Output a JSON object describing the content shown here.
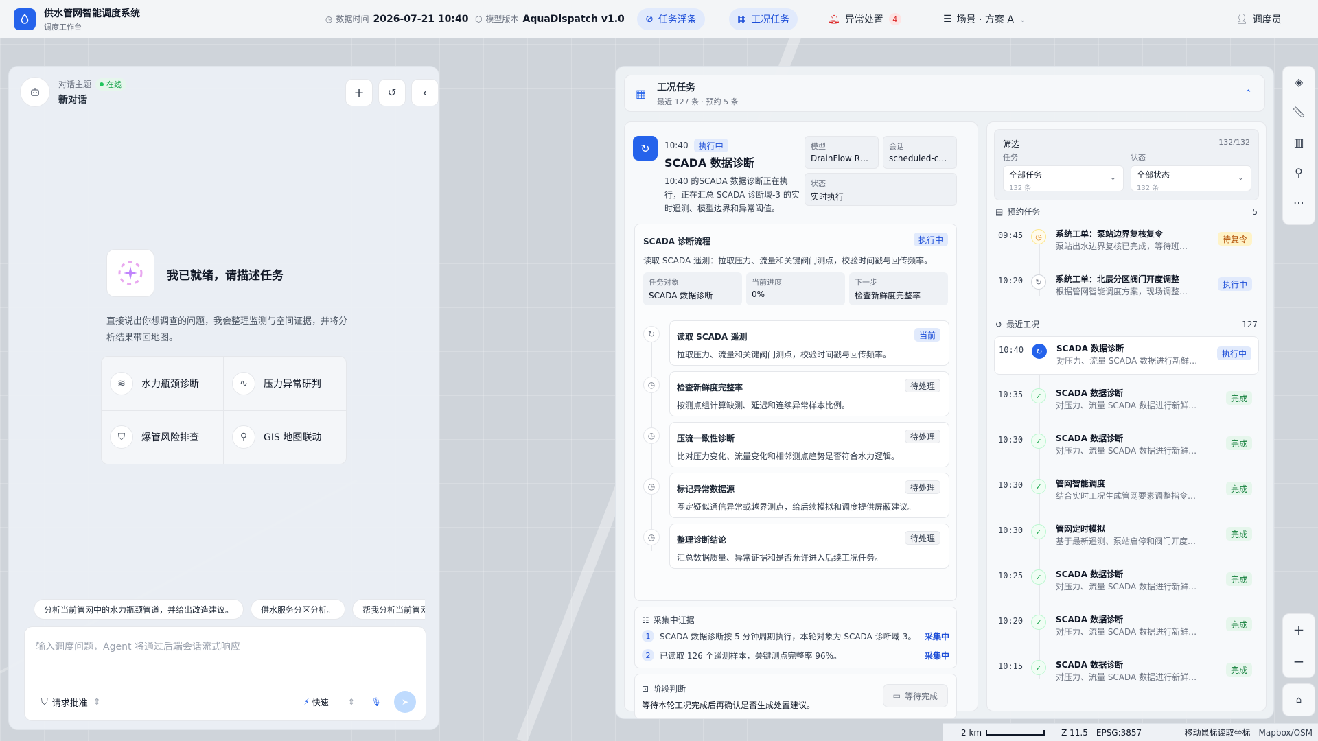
{
  "header": {
    "app_title": "供水管网智能调度系统",
    "app_subtitle": "调度工作台",
    "data_time_label": "数据时间",
    "data_time": "2026-07-21 10:40",
    "model_label": "模型版本",
    "model": "AquaDispatch v1.0",
    "nav": {
      "float_tasks": "任务浮条",
      "work_tasks": "工况任务",
      "anomaly": "异常处置",
      "anomaly_count": "4",
      "scenario": "场景 · 方案 A",
      "user": "调度员"
    }
  },
  "chat": {
    "topic_label": "对话主题",
    "status": "在线",
    "title": "新对话",
    "hero_title": "我已就绪，请描述任务",
    "hero_desc": "直接说出你想调查的问题，我会整理监测与空间证据，并将分析结果带回地图。",
    "quick": [
      "水力瓶颈诊断",
      "压力异常研判",
      "爆管风险排查",
      "GIS 地图联动"
    ],
    "suggestions": [
      "分析当前管网中的水力瓶颈管道，并给出改造建议。",
      "供水服务分区分析。",
      "帮我分析当前管网"
    ],
    "input_placeholder": "输入调度问题，Agent 将通过后端会话流式响应",
    "approval": "请求批准",
    "mode": "快速"
  },
  "tasks": {
    "title": "工况任务",
    "subtitle": "最近 127 条 · 预约 5 条",
    "detail": {
      "time": "10:40",
      "status": "执行中",
      "title": "SCADA 数据诊断",
      "desc": "10:40 的SCADA 数据诊断正在执行，正在汇总 SCADA 诊断域-3 的实时遥测、模型边界和异常阈值。",
      "model_label": "模型",
      "model": "DrainFlow R…",
      "session_label": "会话",
      "session": "scheduled-c…",
      "state_label": "状态",
      "state": "实时执行",
      "flow_title": "SCADA 诊断流程",
      "flow_status": "执行中",
      "flow_desc": "读取 SCADA 遥测：拉取压力、流量和关键阀门测点，校验时间戳与回传频率。",
      "target_label": "任务对象",
      "target": "SCADA 数据诊断",
      "progress_label": "当前进度",
      "progress": "0%",
      "next_label": "下一步",
      "next": "检查新鲜度完整率",
      "steps": [
        {
          "title": "读取 SCADA 遥测",
          "desc": "拉取压力、流量和关键阀门测点，校验时间戳与回传频率。",
          "status": "当前"
        },
        {
          "title": "检查新鲜度完整率",
          "desc": "按测点组计算缺测、延迟和连续异常样本比例。",
          "status": "待处理"
        },
        {
          "title": "压流一致性诊断",
          "desc": "比对压力变化、流量变化和相邻测点趋势是否符合水力逻辑。",
          "status": "待处理"
        },
        {
          "title": "标记异常数据源",
          "desc": "圈定疑似通信异常或越界测点，给后续模拟和调度提供屏蔽建议。",
          "status": "待处理"
        },
        {
          "title": "整理诊断结论",
          "desc": "汇总数据质量、异常证据和是否允许进入后续工况任务。",
          "status": "待处理"
        }
      ],
      "evidence_title": "采集中证据",
      "evidence": [
        {
          "n": "1",
          "text": "SCADA 数据诊断按 5 分钟周期执行，本轮对象为 SCADA 诊断域-3。",
          "status": "采集中"
        },
        {
          "n": "2",
          "text": "已读取 126 个遥测样本，关键测点完整率 96%。",
          "status": "采集中"
        }
      ],
      "judge_title": "阶段判断",
      "judge_desc": "等待本轮工况完成后再确认是否生成处置建议。",
      "judge_btn": "等待完成"
    },
    "filter": {
      "label": "筛选",
      "count": "132/132",
      "task_label": "任务",
      "task_value": "全部任务",
      "task_count": "132 条",
      "state_label": "状态",
      "state_value": "全部状态",
      "state_count": "132 条"
    },
    "scheduled_label": "预约任务",
    "scheduled_count": "5",
    "scheduled": [
      {
        "time": "09:45",
        "title": "系统工单：泵站边界复核复令",
        "desc": "泵站出水边界复核已完成，等待班…",
        "status": "待复令"
      },
      {
        "time": "10:20",
        "title": "系统工单：北辰分区阀门开度调整",
        "desc": "根据管网智能调度方案，现场调整…",
        "status": "执行中"
      }
    ],
    "recent_label": "最近工况",
    "recent_count": "127",
    "recent": [
      {
        "time": "10:40",
        "title": "SCADA 数据诊断",
        "desc": "对压力、流量 SCADA 数据进行新鲜…",
        "status": "执行中"
      },
      {
        "time": "10:35",
        "title": "SCADA 数据诊断",
        "desc": "对压力、流量 SCADA 数据进行新鲜度…",
        "status": "完成"
      },
      {
        "time": "10:30",
        "title": "SCADA 数据诊断",
        "desc": "对压力、流量 SCADA 数据进行新鲜…",
        "status": "完成"
      },
      {
        "time": "10:30",
        "title": "管网智能调度",
        "desc": "结合实时工况生成管网要素调整指令…",
        "status": "完成"
      },
      {
        "time": "10:30",
        "title": "管网定时模拟",
        "desc": "基于最新遥测、泵站启停和阀门开度…",
        "status": "完成"
      },
      {
        "time": "10:25",
        "title": "SCADA 数据诊断",
        "desc": "对压力、流量 SCADA 数据进行新鲜度…",
        "status": "完成"
      },
      {
        "time": "10:20",
        "title": "SCADA 数据诊断",
        "desc": "对压力、流量 SCADA 数据进行新鲜度…",
        "status": "完成"
      },
      {
        "time": "10:15",
        "title": "SCADA 数据诊断",
        "desc": "对压力、流量 SCADA 数据进行新鲜度…",
        "status": "完成"
      }
    ]
  },
  "statusbar": {
    "scale": "2 km",
    "zoom": "Z 11.5",
    "epsg": "EPSG:3857",
    "coords_hint": "移动鼠标读取坐标",
    "attribution": "Mapbox/OSM"
  },
  "colors": {
    "accent": "#2563eb",
    "success": "#16a34a",
    "warning": "#d97706",
    "danger": "#dc2626"
  }
}
